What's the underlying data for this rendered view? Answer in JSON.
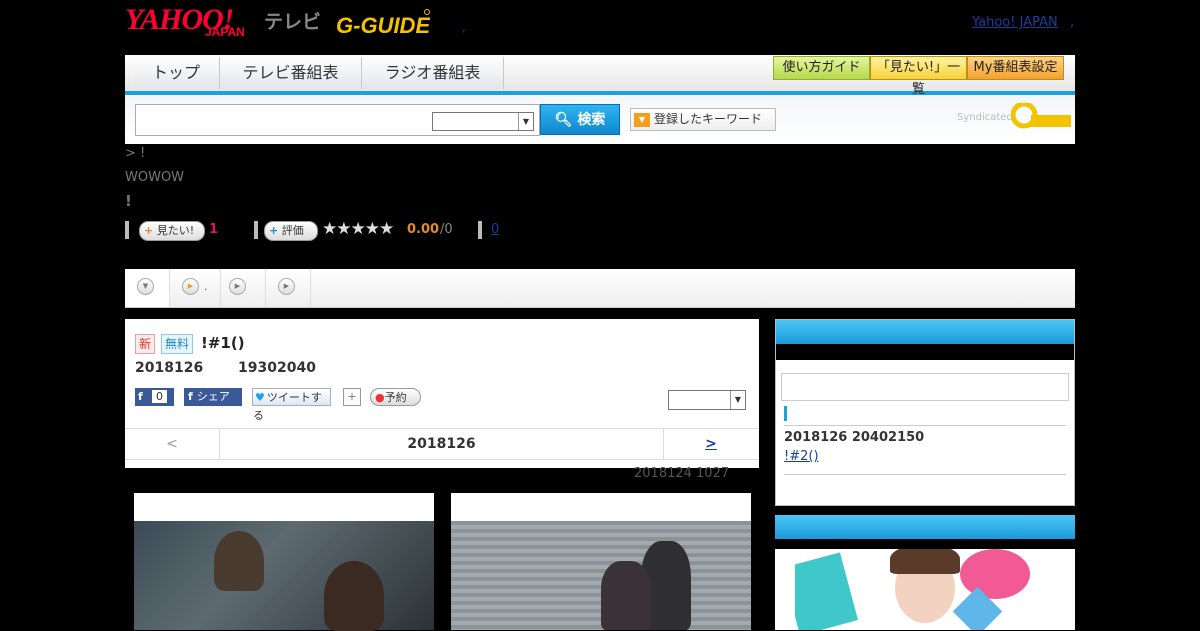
{
  "header": {
    "yahoo_logo": "YAHOO!",
    "japan_logo": "JAPAN",
    "tv_label": "テレビ",
    "gguide_logo": "G-GUIDE",
    "dot": ",",
    "yahoo_japan_link": "Yahoo! JAPAN",
    "link_dot": ","
  },
  "nav": {
    "tabs": [
      "トップ",
      "テレビ番組表",
      "ラジオ番組表"
    ],
    "buttons": [
      "使い方ガイド",
      "「見たい!」一覧",
      "My番組表設定"
    ]
  },
  "search": {
    "button_label": "検索",
    "keyword_button": "登録したキーワード",
    "syndicated": "Syndicated"
  },
  "program": {
    "breadcrumb": "> !",
    "channel": "WOWOW",
    "title_mark": "!",
    "want_label": "見たい!",
    "want_count": "1",
    "rate_label": "評価",
    "stars": "★★★★★",
    "rating": "0.00",
    "rating_count": "/0",
    "review_count": "0"
  },
  "tabs": {
    "tab2_text": "."
  },
  "detail": {
    "badge_new": "新",
    "badge_free": "無料",
    "title": "!#1()",
    "date": "2018126",
    "time": "19302040",
    "fb_count": "0",
    "share": "シェア",
    "tweet": "ツイートする",
    "reserve": "予約",
    "prev": "<",
    "nav_date": "2018126",
    "next": ">",
    "updated": "2018124  1027"
  },
  "sidebar": {
    "next_date": "2018126  20402150",
    "next_title": "!#2()"
  },
  "colors": {
    "accent": "#1aa1e0",
    "yahoo_red": "#ff0033",
    "rating_orange": "#e38b2b",
    "want_pink": "#e0115f"
  }
}
